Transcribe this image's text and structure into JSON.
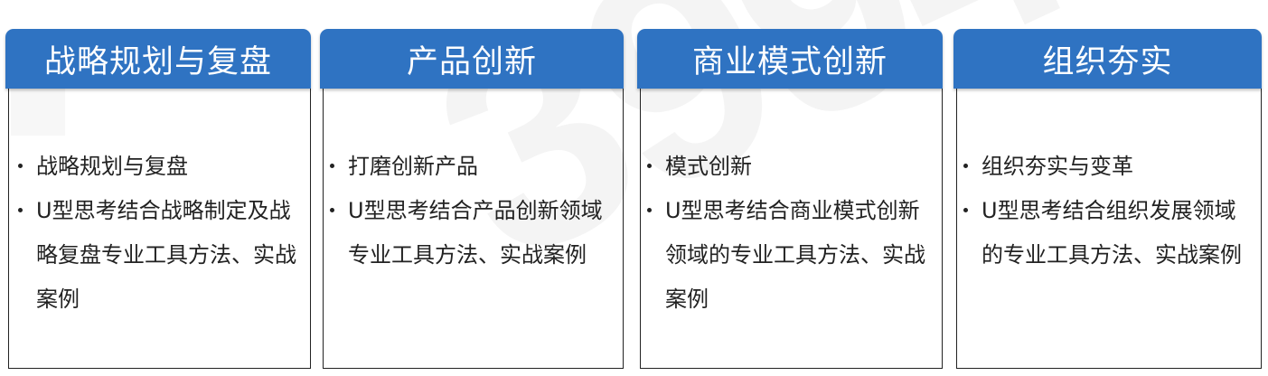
{
  "columns": [
    {
      "title": "战略规划与复盘",
      "bullets": [
        "战略规划与复盘",
        "U型思考结合战略制定及战略复盘专业工具方法、实战案例"
      ]
    },
    {
      "title": "产品创新",
      "bullets": [
        "打磨创新产品",
        "U型思考结合产品创新领域专业工具方法、实战案例"
      ]
    },
    {
      "title": "商业模式创新",
      "bullets": [
        "模式创新",
        "U型思考结合商业模式创新领域的专业工具方法、实战案例"
      ]
    },
    {
      "title": "组织夯实",
      "bullets": [
        "组织夯实与变革",
        "U型思考结合组织发展领域的专业工具方法、实战案例"
      ]
    }
  ],
  "colors": {
    "header_bg": "#2f73c2",
    "header_text": "#ffffff",
    "body_text": "#222222",
    "border": "#222222"
  }
}
